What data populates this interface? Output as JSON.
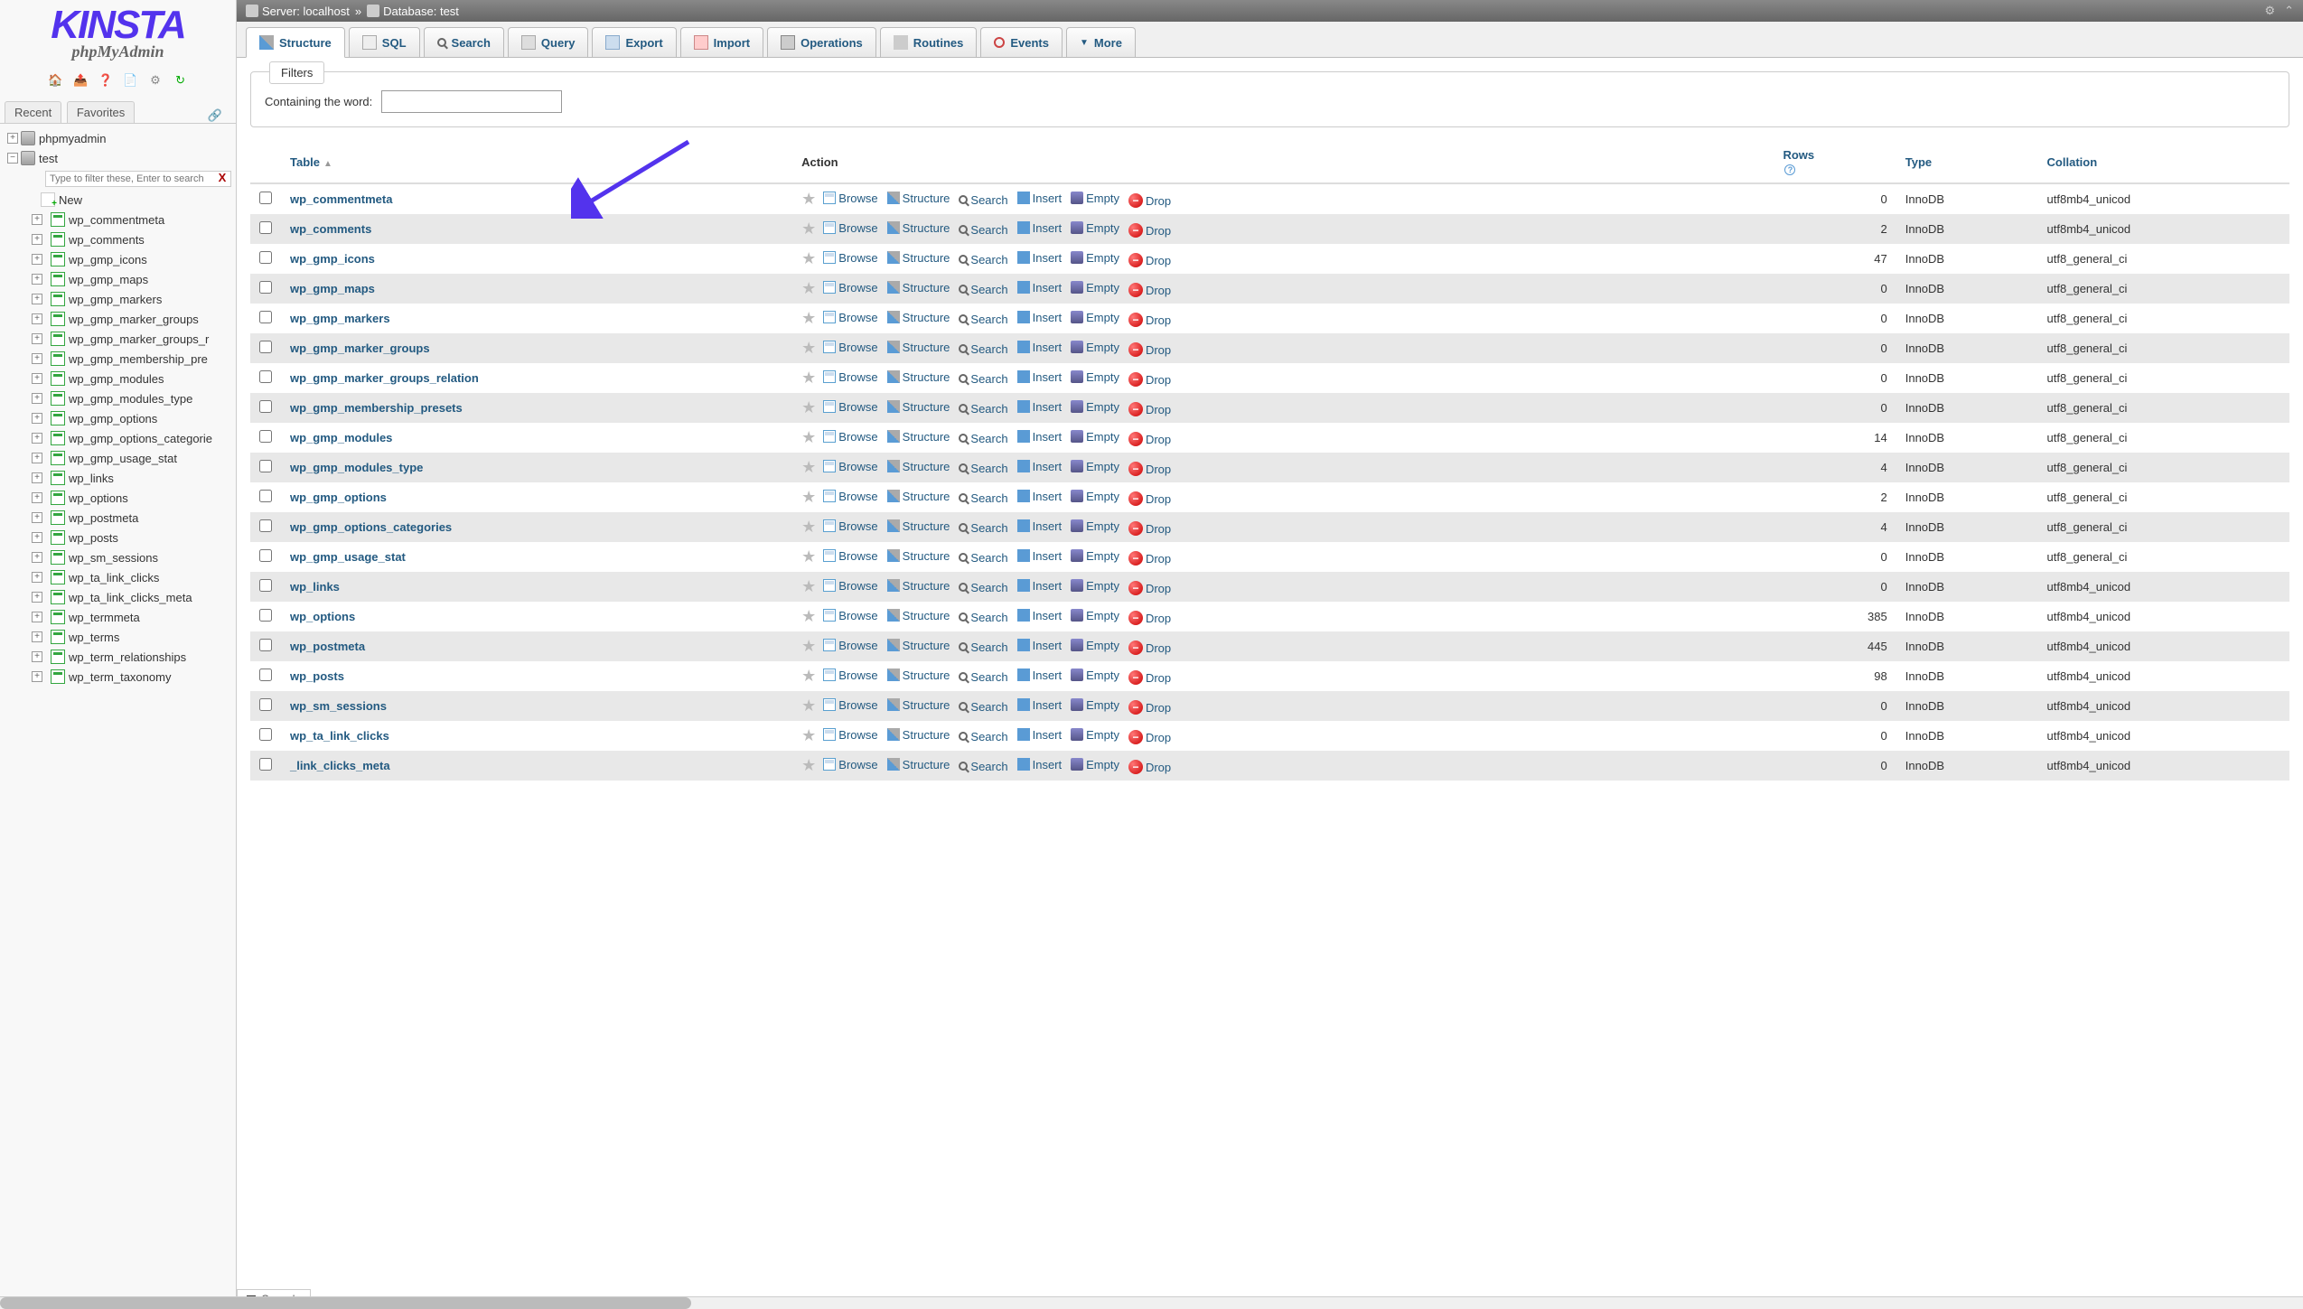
{
  "logo": {
    "main": "KINSTA",
    "sub": "phpMyAdmin"
  },
  "sidebar_tabs": {
    "recent": "Recent",
    "favorites": "Favorites"
  },
  "tree": {
    "root": "phpmyadmin",
    "db": "test",
    "filter_placeholder": "Type to filter these, Enter to search",
    "new": "New",
    "tables": [
      "wp_commentmeta",
      "wp_comments",
      "wp_gmp_icons",
      "wp_gmp_maps",
      "wp_gmp_markers",
      "wp_gmp_marker_groups",
      "wp_gmp_marker_groups_r",
      "wp_gmp_membership_pre",
      "wp_gmp_modules",
      "wp_gmp_modules_type",
      "wp_gmp_options",
      "wp_gmp_options_categorie",
      "wp_gmp_usage_stat",
      "wp_links",
      "wp_options",
      "wp_postmeta",
      "wp_posts",
      "wp_sm_sessions",
      "wp_ta_link_clicks",
      "wp_ta_link_clicks_meta",
      "wp_termmeta",
      "wp_terms",
      "wp_term_relationships",
      "wp_term_taxonomy"
    ]
  },
  "breadcrumb": {
    "server_label": "Server:",
    "server": "localhost",
    "db_label": "Database:",
    "db": "test"
  },
  "nav": {
    "structure": "Structure",
    "sql": "SQL",
    "search": "Search",
    "query": "Query",
    "export": "Export",
    "import": "Import",
    "operations": "Operations",
    "routines": "Routines",
    "events": "Events",
    "more": "More"
  },
  "filters": {
    "legend": "Filters",
    "label": "Containing the word:"
  },
  "headers": {
    "table": "Table",
    "action": "Action",
    "rows": "Rows",
    "type": "Type",
    "collation": "Collation"
  },
  "actions": {
    "browse": "Browse",
    "structure": "Structure",
    "search": "Search",
    "insert": "Insert",
    "empty": "Empty",
    "drop": "Drop"
  },
  "rows": [
    {
      "name": "wp_commentmeta",
      "rows": "0",
      "type": "InnoDB",
      "collation": "utf8mb4_unicod"
    },
    {
      "name": "wp_comments",
      "rows": "2",
      "type": "InnoDB",
      "collation": "utf8mb4_unicod"
    },
    {
      "name": "wp_gmp_icons",
      "rows": "47",
      "type": "InnoDB",
      "collation": "utf8_general_ci"
    },
    {
      "name": "wp_gmp_maps",
      "rows": "0",
      "type": "InnoDB",
      "collation": "utf8_general_ci"
    },
    {
      "name": "wp_gmp_markers",
      "rows": "0",
      "type": "InnoDB",
      "collation": "utf8_general_ci"
    },
    {
      "name": "wp_gmp_marker_groups",
      "rows": "0",
      "type": "InnoDB",
      "collation": "utf8_general_ci"
    },
    {
      "name": "wp_gmp_marker_groups_relation",
      "rows": "0",
      "type": "InnoDB",
      "collation": "utf8_general_ci"
    },
    {
      "name": "wp_gmp_membership_presets",
      "rows": "0",
      "type": "InnoDB",
      "collation": "utf8_general_ci"
    },
    {
      "name": "wp_gmp_modules",
      "rows": "14",
      "type": "InnoDB",
      "collation": "utf8_general_ci"
    },
    {
      "name": "wp_gmp_modules_type",
      "rows": "4",
      "type": "InnoDB",
      "collation": "utf8_general_ci"
    },
    {
      "name": "wp_gmp_options",
      "rows": "2",
      "type": "InnoDB",
      "collation": "utf8_general_ci"
    },
    {
      "name": "wp_gmp_options_categories",
      "rows": "4",
      "type": "InnoDB",
      "collation": "utf8_general_ci"
    },
    {
      "name": "wp_gmp_usage_stat",
      "rows": "0",
      "type": "InnoDB",
      "collation": "utf8_general_ci"
    },
    {
      "name": "wp_links",
      "rows": "0",
      "type": "InnoDB",
      "collation": "utf8mb4_unicod"
    },
    {
      "name": "wp_options",
      "rows": "385",
      "type": "InnoDB",
      "collation": "utf8mb4_unicod"
    },
    {
      "name": "wp_postmeta",
      "rows": "445",
      "type": "InnoDB",
      "collation": "utf8mb4_unicod"
    },
    {
      "name": "wp_posts",
      "rows": "98",
      "type": "InnoDB",
      "collation": "utf8mb4_unicod"
    },
    {
      "name": "wp_sm_sessions",
      "rows": "0",
      "type": "InnoDB",
      "collation": "utf8mb4_unicod"
    },
    {
      "name": "wp_ta_link_clicks",
      "rows": "0",
      "type": "InnoDB",
      "collation": "utf8mb4_unicod"
    },
    {
      "name": "_link_clicks_meta",
      "rows": "0",
      "type": "InnoDB",
      "collation": "utf8mb4_unicod"
    }
  ],
  "console": "Console"
}
